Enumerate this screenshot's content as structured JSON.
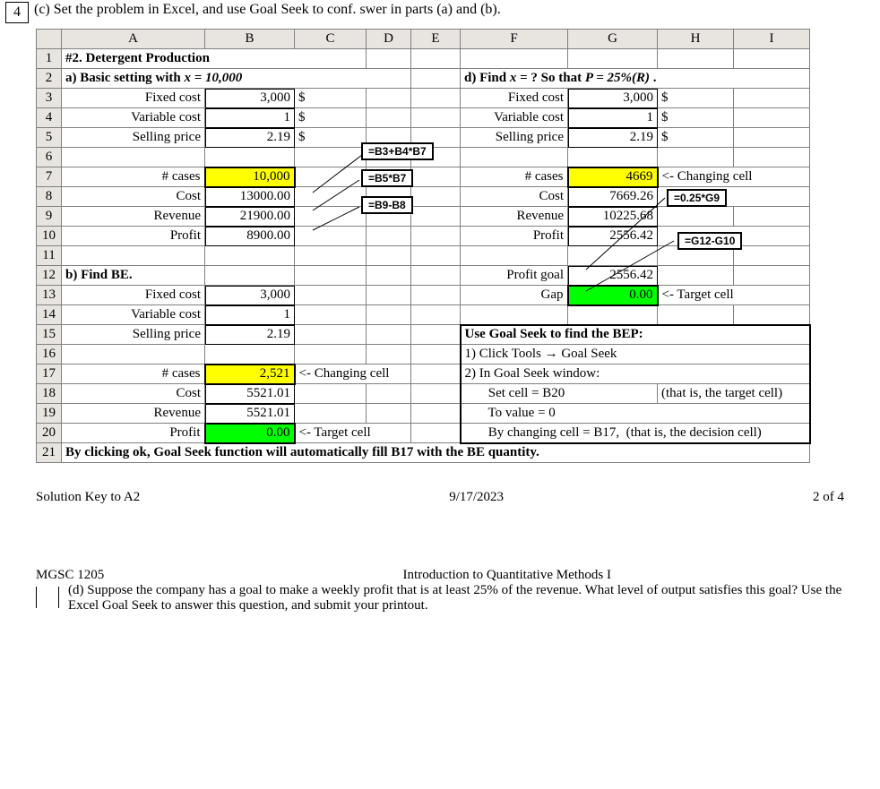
{
  "page": {
    "number": "4",
    "problem_c": "(c) Set the problem in Excel, and use Goal Seek to conf.                    swer in parts (a) and (b)."
  },
  "columns": [
    "A",
    "B",
    "C",
    "D",
    "E",
    "F",
    "G",
    "H",
    "I"
  ],
  "rows": {
    "r1": {
      "A": "#2. Detergent Production"
    },
    "r2": {
      "A": "a) Basic setting with x = 10,000",
      "F": "d) Find x = ? So that P = 25%(R) ."
    },
    "r3": {
      "A": "Fixed cost",
      "B": "3,000",
      "C": "$",
      "F": "Fixed cost",
      "G": "3,000",
      "H": "$"
    },
    "r4": {
      "A": "Variable cost",
      "B": "1",
      "C": "$",
      "F": "Variable cost",
      "G": "1",
      "H": "$"
    },
    "r5": {
      "A": "Selling price",
      "B": "2.19",
      "C": "$",
      "F": "Selling price",
      "G": "2.19",
      "H": "$"
    },
    "r7": {
      "A": "# cases",
      "B": "10,000",
      "F": "# cases",
      "G": "4669",
      "H": "<- Changing cell"
    },
    "r8": {
      "A": "Cost",
      "B": "13000.00",
      "F": "Cost",
      "G": "7669.26"
    },
    "r9": {
      "A": "Revenue",
      "B": "21900.00",
      "F": "Revenue",
      "G": "10225.68"
    },
    "r10": {
      "A": "Profit",
      "B": "8900.00",
      "F": "Profit",
      "G": "2556.42"
    },
    "r12": {
      "A": "b) Find BE.",
      "F": "Profit goal",
      "G": "2556.42"
    },
    "r13": {
      "A": "Fixed cost",
      "B": "3,000",
      "F": "Gap",
      "G": "0.00",
      "H": "<- Target cell"
    },
    "r14": {
      "A": "Variable cost",
      "B": "1"
    },
    "r15": {
      "A": "Selling price",
      "B": "2.19",
      "F": "Use Goal Seek to find the BEP:"
    },
    "r16": {
      "F": "1) Click Tools → Goal Seek"
    },
    "r17": {
      "A": "# cases",
      "B": "2,521",
      "C": "<- Changing cell",
      "F": "2) In Goal Seek window:"
    },
    "r18": {
      "A": "Cost",
      "B": "5521.01",
      "F": "       Set cell = B20",
      "H": "(that is, the target cell)"
    },
    "r19": {
      "A": "Revenue",
      "B": "5521.01",
      "F": "       To value = 0"
    },
    "r20": {
      "A": "Profit",
      "B": "0.00",
      "C": "<- Target cell",
      "F": "       By changing cell = B17,  (that is, the decision cell)"
    },
    "r21": {
      "A": "By clicking ok, Goal Seek function will automatically fill B17 with the BE quantity."
    }
  },
  "callouts": {
    "c1": "=B3+B4*B7",
    "c2": "=B5*B7",
    "c3": "=B9-B8",
    "c4": "=0.25*G9",
    "c5": "=G12-G10"
  },
  "footer": {
    "solution_key": "Solution Key to A2",
    "date": "9/17/2023",
    "pagenum": "2 of 4",
    "course_code": "MGSC 1205",
    "course_title": "Introduction to Quantitative Methods I",
    "q_d": "(d) Suppose the company has a goal to make a weekly profit that is at least 25% of the revenue. What level of output satisfies this goal? Use the Excel Goal Seek to answer this question, and submit your printout."
  }
}
